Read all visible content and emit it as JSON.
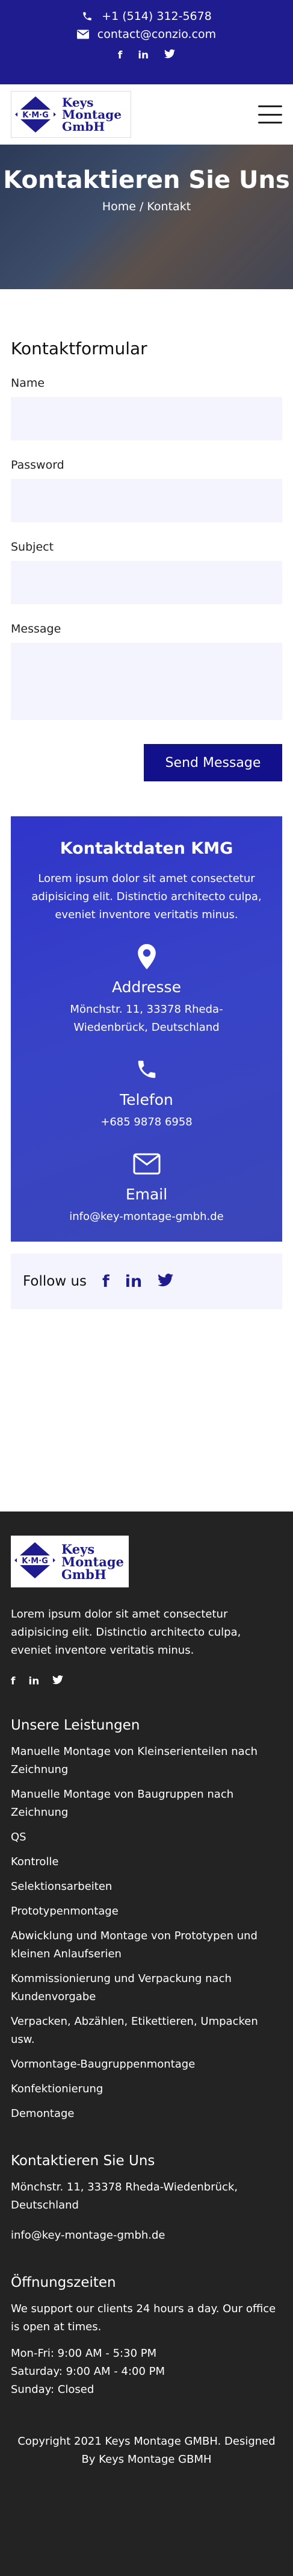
{
  "topbar": {
    "phone": "+1 (514) 312-5678",
    "email": "contact@conzio.com",
    "social": [
      "f",
      "in",
      "t"
    ]
  },
  "brand": {
    "line1": "Keys",
    "line2": "Montage",
    "line3": "GmbH",
    "mark": "K·M·G"
  },
  "hero": {
    "title": "Kontaktieren Sie Uns",
    "breadcrumb": "Home / Kontakt"
  },
  "form": {
    "heading": "Kontaktformular",
    "name_label": "Name",
    "password_label": "Password",
    "subject_label": "Subject",
    "message_label": "Message",
    "send_label": "Send Message"
  },
  "contact": {
    "heading": "Kontaktdaten KMG",
    "lead": "Lorem ipsum dolor sit amet consectetur adipisicing elit. Distinctio architecto culpa, eveniet inventore veritatis minus.",
    "address_title": "Addresse",
    "address": "Mönchstr. 11, 33378 Rheda-Wiedenbrück, Deutschland",
    "phone_title": "Telefon",
    "phone": "+685 9878 6958",
    "email_title": "Email",
    "email": "info@key-montage-gmbh.de"
  },
  "follow": {
    "label": "Follow us",
    "icons": [
      "f",
      "in",
      "t"
    ]
  },
  "footer": {
    "about": "Lorem ipsum dolor sit amet consectetur adipisicing elit. Distinctio architecto culpa, eveniet inventore veritatis minus.",
    "social": [
      "f",
      "in",
      "t"
    ],
    "services_title": "Unsere Leistungen",
    "services": [
      "Manuelle Montage von Kleinserienteilen nach Zeichnung",
      "Manuelle Montage von Baugruppen nach Zeichnung",
      "QS",
      "Kontrolle",
      "Selektionsarbeiten",
      "Prototypenmontage",
      "Abwicklung und Montage von Prototypen und kleinen Anlaufserien",
      "Kommissionierung und Verpackung nach Kundenvorgabe",
      "Verpacken, Abzählen, Etikettieren, Umpacken usw.",
      "Vormontage-Baugruppenmontage",
      "Konfektionierung",
      "Demontage"
    ],
    "contact_title": "Kontaktieren Sie Uns",
    "contact_address": "Mönchstr. 11, 33378 Rheda-Wiedenbrück, Deutschland",
    "contact_email": "info@key-montage-gmbh.de",
    "hours_title": "Öffnungszeiten",
    "hours_text": "We support our clients 24 hours a day. Our office is open at times.",
    "hours": [
      "Mon-Fri: 9:00 AM - 5:30 PM",
      "Saturday: 9:00 AM - 4:00 PM",
      "Sunday: Closed"
    ],
    "copyright": "Copyright 2021 Keys Montage GMBH. Designed By Keys Montage GBMH"
  },
  "colors": {
    "primary": "#1f1c8f",
    "button": "#12108a",
    "contact_panel": "#3440c6",
    "footer_bg": "#232323",
    "field_bg": "#f3f4fd"
  }
}
